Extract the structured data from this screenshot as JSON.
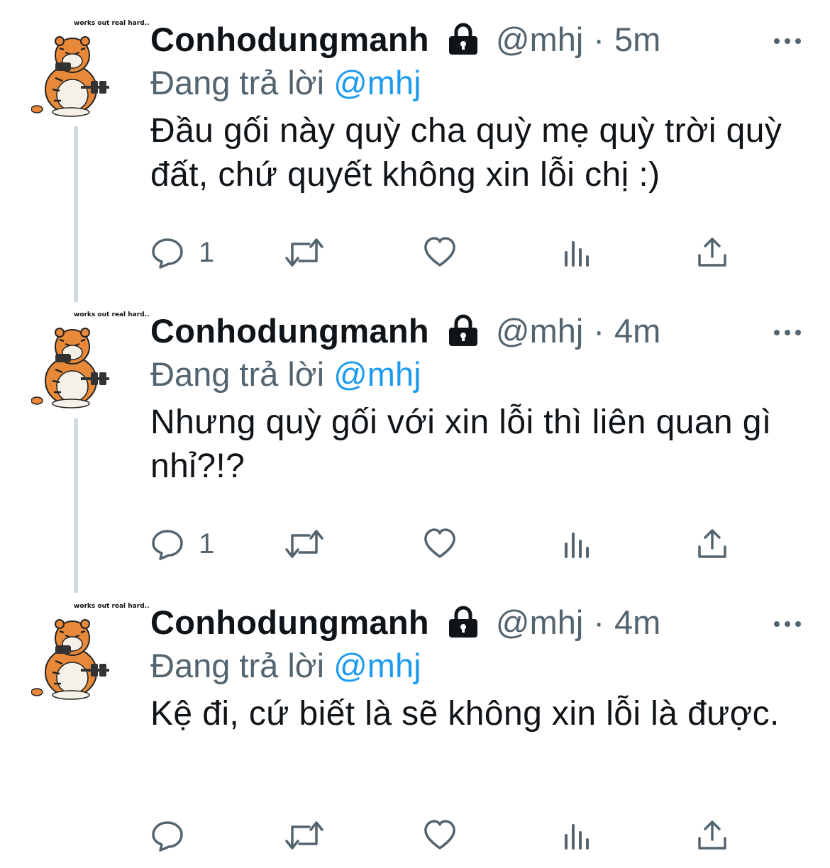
{
  "tweets": [
    {
      "avatar_caption": "works out real hard..",
      "display_name": "Conhodungmanh",
      "handle": "@mhj",
      "separator": "·",
      "time": "5m",
      "replying_prefix": "Đang trả lời",
      "replying_to": "@mhj",
      "text": "Đầu gối này quỳ cha quỳ mẹ quỳ trời quỳ đất, chứ quyết không xin lỗi chị :)",
      "reply_count": "1"
    },
    {
      "avatar_caption": "works out real hard..",
      "display_name": "Conhodungmanh",
      "handle": "@mhj",
      "separator": "·",
      "time": "4m",
      "replying_prefix": "Đang trả lời",
      "replying_to": "@mhj",
      "text": "Nhưng quỳ gối với xin lỗi thì liên quan gì nhỉ?!?",
      "reply_count": "1"
    },
    {
      "avatar_caption": "works out real hard..",
      "display_name": "Conhodungmanh",
      "handle": "@mhj",
      "separator": "·",
      "time": "4m",
      "replying_prefix": "Đang trả lời",
      "replying_to": "@mhj",
      "text": "Kệ đi, cứ biết là sẽ không xin lỗi là được.",
      "reply_count": ""
    }
  ],
  "icons": {
    "reply": "speech-bubble-icon",
    "retweet": "retweet-arrows-icon",
    "like": "heart-icon",
    "views": "bar-chart-icon",
    "share": "upload-arrow-icon",
    "lock": "padlock-icon",
    "more": "three-dots-icon"
  },
  "colors": {
    "text": "#0f1419",
    "secondary": "#536471",
    "accent": "#1d9bf0",
    "thread_line": "#cfd9de",
    "tiger_orange": "#e8893a"
  }
}
